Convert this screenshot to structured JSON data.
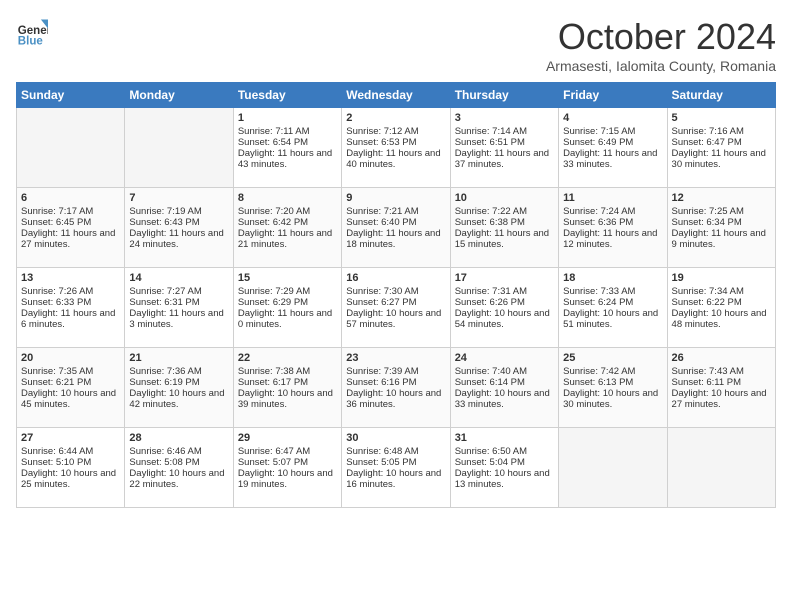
{
  "header": {
    "logo_line1": "General",
    "logo_line2": "Blue",
    "month_title": "October 2024",
    "location": "Armasesti, Ialomita County, Romania"
  },
  "days_of_week": [
    "Sunday",
    "Monday",
    "Tuesday",
    "Wednesday",
    "Thursday",
    "Friday",
    "Saturday"
  ],
  "weeks": [
    [
      {
        "num": "",
        "sunrise": "",
        "sunset": "",
        "daylight": "",
        "empty": true
      },
      {
        "num": "",
        "sunrise": "",
        "sunset": "",
        "daylight": "",
        "empty": true
      },
      {
        "num": "1",
        "sunrise": "Sunrise: 7:11 AM",
        "sunset": "Sunset: 6:54 PM",
        "daylight": "Daylight: 11 hours and 43 minutes."
      },
      {
        "num": "2",
        "sunrise": "Sunrise: 7:12 AM",
        "sunset": "Sunset: 6:53 PM",
        "daylight": "Daylight: 11 hours and 40 minutes."
      },
      {
        "num": "3",
        "sunrise": "Sunrise: 7:14 AM",
        "sunset": "Sunset: 6:51 PM",
        "daylight": "Daylight: 11 hours and 37 minutes."
      },
      {
        "num": "4",
        "sunrise": "Sunrise: 7:15 AM",
        "sunset": "Sunset: 6:49 PM",
        "daylight": "Daylight: 11 hours and 33 minutes."
      },
      {
        "num": "5",
        "sunrise": "Sunrise: 7:16 AM",
        "sunset": "Sunset: 6:47 PM",
        "daylight": "Daylight: 11 hours and 30 minutes."
      }
    ],
    [
      {
        "num": "6",
        "sunrise": "Sunrise: 7:17 AM",
        "sunset": "Sunset: 6:45 PM",
        "daylight": "Daylight: 11 hours and 27 minutes."
      },
      {
        "num": "7",
        "sunrise": "Sunrise: 7:19 AM",
        "sunset": "Sunset: 6:43 PM",
        "daylight": "Daylight: 11 hours and 24 minutes."
      },
      {
        "num": "8",
        "sunrise": "Sunrise: 7:20 AM",
        "sunset": "Sunset: 6:42 PM",
        "daylight": "Daylight: 11 hours and 21 minutes."
      },
      {
        "num": "9",
        "sunrise": "Sunrise: 7:21 AM",
        "sunset": "Sunset: 6:40 PM",
        "daylight": "Daylight: 11 hours and 18 minutes."
      },
      {
        "num": "10",
        "sunrise": "Sunrise: 7:22 AM",
        "sunset": "Sunset: 6:38 PM",
        "daylight": "Daylight: 11 hours and 15 minutes."
      },
      {
        "num": "11",
        "sunrise": "Sunrise: 7:24 AM",
        "sunset": "Sunset: 6:36 PM",
        "daylight": "Daylight: 11 hours and 12 minutes."
      },
      {
        "num": "12",
        "sunrise": "Sunrise: 7:25 AM",
        "sunset": "Sunset: 6:34 PM",
        "daylight": "Daylight: 11 hours and 9 minutes."
      }
    ],
    [
      {
        "num": "13",
        "sunrise": "Sunrise: 7:26 AM",
        "sunset": "Sunset: 6:33 PM",
        "daylight": "Daylight: 11 hours and 6 minutes."
      },
      {
        "num": "14",
        "sunrise": "Sunrise: 7:27 AM",
        "sunset": "Sunset: 6:31 PM",
        "daylight": "Daylight: 11 hours and 3 minutes."
      },
      {
        "num": "15",
        "sunrise": "Sunrise: 7:29 AM",
        "sunset": "Sunset: 6:29 PM",
        "daylight": "Daylight: 11 hours and 0 minutes."
      },
      {
        "num": "16",
        "sunrise": "Sunrise: 7:30 AM",
        "sunset": "Sunset: 6:27 PM",
        "daylight": "Daylight: 10 hours and 57 minutes."
      },
      {
        "num": "17",
        "sunrise": "Sunrise: 7:31 AM",
        "sunset": "Sunset: 6:26 PM",
        "daylight": "Daylight: 10 hours and 54 minutes."
      },
      {
        "num": "18",
        "sunrise": "Sunrise: 7:33 AM",
        "sunset": "Sunset: 6:24 PM",
        "daylight": "Daylight: 10 hours and 51 minutes."
      },
      {
        "num": "19",
        "sunrise": "Sunrise: 7:34 AM",
        "sunset": "Sunset: 6:22 PM",
        "daylight": "Daylight: 10 hours and 48 minutes."
      }
    ],
    [
      {
        "num": "20",
        "sunrise": "Sunrise: 7:35 AM",
        "sunset": "Sunset: 6:21 PM",
        "daylight": "Daylight: 10 hours and 45 minutes."
      },
      {
        "num": "21",
        "sunrise": "Sunrise: 7:36 AM",
        "sunset": "Sunset: 6:19 PM",
        "daylight": "Daylight: 10 hours and 42 minutes."
      },
      {
        "num": "22",
        "sunrise": "Sunrise: 7:38 AM",
        "sunset": "Sunset: 6:17 PM",
        "daylight": "Daylight: 10 hours and 39 minutes."
      },
      {
        "num": "23",
        "sunrise": "Sunrise: 7:39 AM",
        "sunset": "Sunset: 6:16 PM",
        "daylight": "Daylight: 10 hours and 36 minutes."
      },
      {
        "num": "24",
        "sunrise": "Sunrise: 7:40 AM",
        "sunset": "Sunset: 6:14 PM",
        "daylight": "Daylight: 10 hours and 33 minutes."
      },
      {
        "num": "25",
        "sunrise": "Sunrise: 7:42 AM",
        "sunset": "Sunset: 6:13 PM",
        "daylight": "Daylight: 10 hours and 30 minutes."
      },
      {
        "num": "26",
        "sunrise": "Sunrise: 7:43 AM",
        "sunset": "Sunset: 6:11 PM",
        "daylight": "Daylight: 10 hours and 27 minutes."
      }
    ],
    [
      {
        "num": "27",
        "sunrise": "Sunrise: 6:44 AM",
        "sunset": "Sunset: 5:10 PM",
        "daylight": "Daylight: 10 hours and 25 minutes."
      },
      {
        "num": "28",
        "sunrise": "Sunrise: 6:46 AM",
        "sunset": "Sunset: 5:08 PM",
        "daylight": "Daylight: 10 hours and 22 minutes."
      },
      {
        "num": "29",
        "sunrise": "Sunrise: 6:47 AM",
        "sunset": "Sunset: 5:07 PM",
        "daylight": "Daylight: 10 hours and 19 minutes."
      },
      {
        "num": "30",
        "sunrise": "Sunrise: 6:48 AM",
        "sunset": "Sunset: 5:05 PM",
        "daylight": "Daylight: 10 hours and 16 minutes."
      },
      {
        "num": "31",
        "sunrise": "Sunrise: 6:50 AM",
        "sunset": "Sunset: 5:04 PM",
        "daylight": "Daylight: 10 hours and 13 minutes."
      },
      {
        "num": "",
        "sunrise": "",
        "sunset": "",
        "daylight": "",
        "empty": true
      },
      {
        "num": "",
        "sunrise": "",
        "sunset": "",
        "daylight": "",
        "empty": true
      }
    ]
  ]
}
